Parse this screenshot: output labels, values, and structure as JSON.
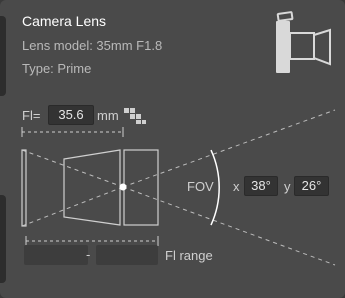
{
  "panel": {
    "title": "Camera Lens",
    "lens_model": "Lens model: 35mm F1.8",
    "type": "Type: Prime"
  },
  "focal": {
    "label": "Fl=",
    "value": "35.6",
    "unit": "mm"
  },
  "fov": {
    "label": "FOV",
    "x_label": "x",
    "x_value": "38°",
    "y_label": "y",
    "y_value": "26°"
  },
  "range": {
    "separator": "-",
    "label": "Fl range"
  },
  "icons": {
    "camera": "camera-icon",
    "grid": "grid-icon"
  },
  "colors": {
    "panel_bg": "#4a4a4a",
    "line": "#cfcfcf",
    "field_bg": "#333333"
  }
}
